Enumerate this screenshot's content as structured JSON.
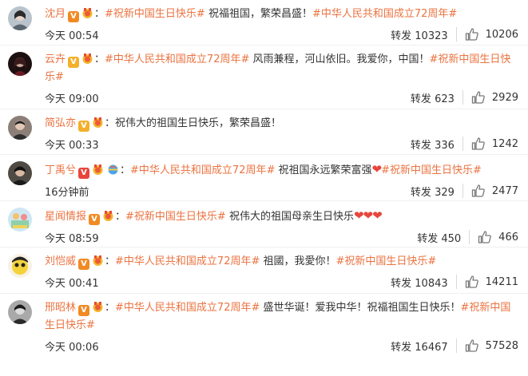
{
  "colors": {
    "accent": "#eb7340",
    "heart": "#e8453c",
    "vip": "#f08a24"
  },
  "icons": {
    "verify": "v-badge-icon",
    "medal": "medal-icon",
    "like": "thumb-up-icon",
    "heart": "heart-icon",
    "globe": "globe-icon"
  },
  "posts": [
    {
      "user": "沈月",
      "badge": "V",
      "segments": [
        {
          "t": "topic",
          "v": "#祝新中国生日快乐#"
        },
        {
          "t": "text",
          "v": " 祝福祖国，繁荣昌盛！"
        },
        {
          "t": "topic",
          "v": "#中华人民共和国成立72周年#"
        }
      ],
      "time": "今天 00:54",
      "repost_label": "转发",
      "repost_count": "10323",
      "likes": "10206"
    },
    {
      "user": "云卉",
      "badge": "V",
      "segments": [
        {
          "t": "topic",
          "v": "#中华人民共和国成立72周年#"
        },
        {
          "t": "text",
          "v": " 风雨兼程，河山依旧。我爱你，中国！"
        },
        {
          "t": "topic",
          "v": "#祝新中国生日快乐#"
        }
      ],
      "time": "今天 09:00",
      "repost_label": "转发",
      "repost_count": "623",
      "likes": "2929"
    },
    {
      "user": "简弘亦",
      "badge": "V",
      "segments": [
        {
          "t": "text",
          "v": "祝伟大的祖国生日快乐，繁荣昌盛！"
        }
      ],
      "time": "今天 00:33",
      "repost_label": "转发",
      "repost_count": "336",
      "likes": "1242"
    },
    {
      "user": "丁禹兮",
      "badge": "V",
      "segments": [
        {
          "t": "topic",
          "v": "#中华人民共和国成立72周年#"
        },
        {
          "t": "text",
          "v": " 祝祖国永远繁荣富强"
        },
        {
          "t": "heart",
          "v": "❤"
        },
        {
          "t": "topic",
          "v": "#祝新中国生日快乐#"
        }
      ],
      "time": "16分钟前",
      "repost_label": "转发",
      "repost_count": "329",
      "likes": "2477"
    },
    {
      "user": "星闻情报",
      "badge": "V",
      "segments": [
        {
          "t": "topic",
          "v": "#祝新中国生日快乐#"
        },
        {
          "t": "text",
          "v": " 祝伟大的祖国母亲生日快乐"
        },
        {
          "t": "heart",
          "v": "❤❤❤"
        }
      ],
      "time": "今天 08:59",
      "repost_label": "转发",
      "repost_count": "450",
      "likes": "466"
    },
    {
      "user": "刘恺威",
      "badge": "V",
      "segments": [
        {
          "t": "topic",
          "v": "#中华人民共和国成立72周年#"
        },
        {
          "t": "text",
          "v": " 祖國，我愛你！"
        },
        {
          "t": "topic",
          "v": "#祝新中国生日快乐#"
        }
      ],
      "time": "今天 00:41",
      "repost_label": "转发",
      "repost_count": "10843",
      "likes": "14211"
    },
    {
      "user": "邢昭林",
      "badge": "V",
      "segments": [
        {
          "t": "topic",
          "v": "#中华人民共和国成立72周年#"
        },
        {
          "t": "text",
          "v": " 盛世华诞！爱我中华！祝福祖国生日快乐！"
        },
        {
          "t": "topic",
          "v": "#祝新中国生日快乐#"
        }
      ],
      "time": "今天 00:06",
      "repost_label": "转发",
      "repost_count": "16467",
      "likes": "57528"
    }
  ]
}
